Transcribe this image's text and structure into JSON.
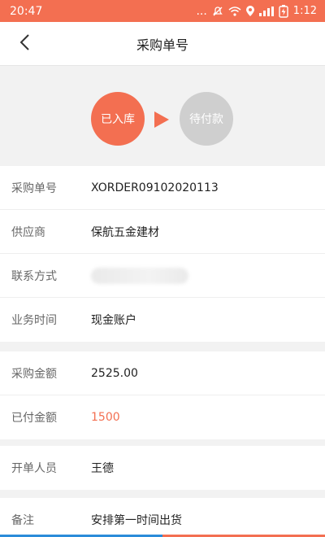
{
  "status_bar": {
    "time": "20:47",
    "dots": "...",
    "time_right": "1:12"
  },
  "header": {
    "title": "采购单号",
    "back_icon": "chevron-left-icon"
  },
  "progress": {
    "step_done": "已入库",
    "step_pending": "待付款"
  },
  "info": {
    "order_no_label": "采购单号",
    "order_no_value": "XORDER09102020113",
    "supplier_label": "供应商",
    "supplier_value": "保航五金建材",
    "contact_label": "联系方式",
    "business_time_label": "业务时间",
    "business_time_value": "现金账户"
  },
  "amounts": {
    "purchase_amount_label": "采购金额",
    "purchase_amount_value": "2525.00",
    "paid_amount_label": "已付金额",
    "paid_amount_value": "1500"
  },
  "creator": {
    "label": "开单人员",
    "value": "王德"
  },
  "remark": {
    "label": "备注",
    "value": "安排第一时间出货"
  },
  "colors": {
    "accent": "#f36f51",
    "pending": "#cfcfcf"
  }
}
